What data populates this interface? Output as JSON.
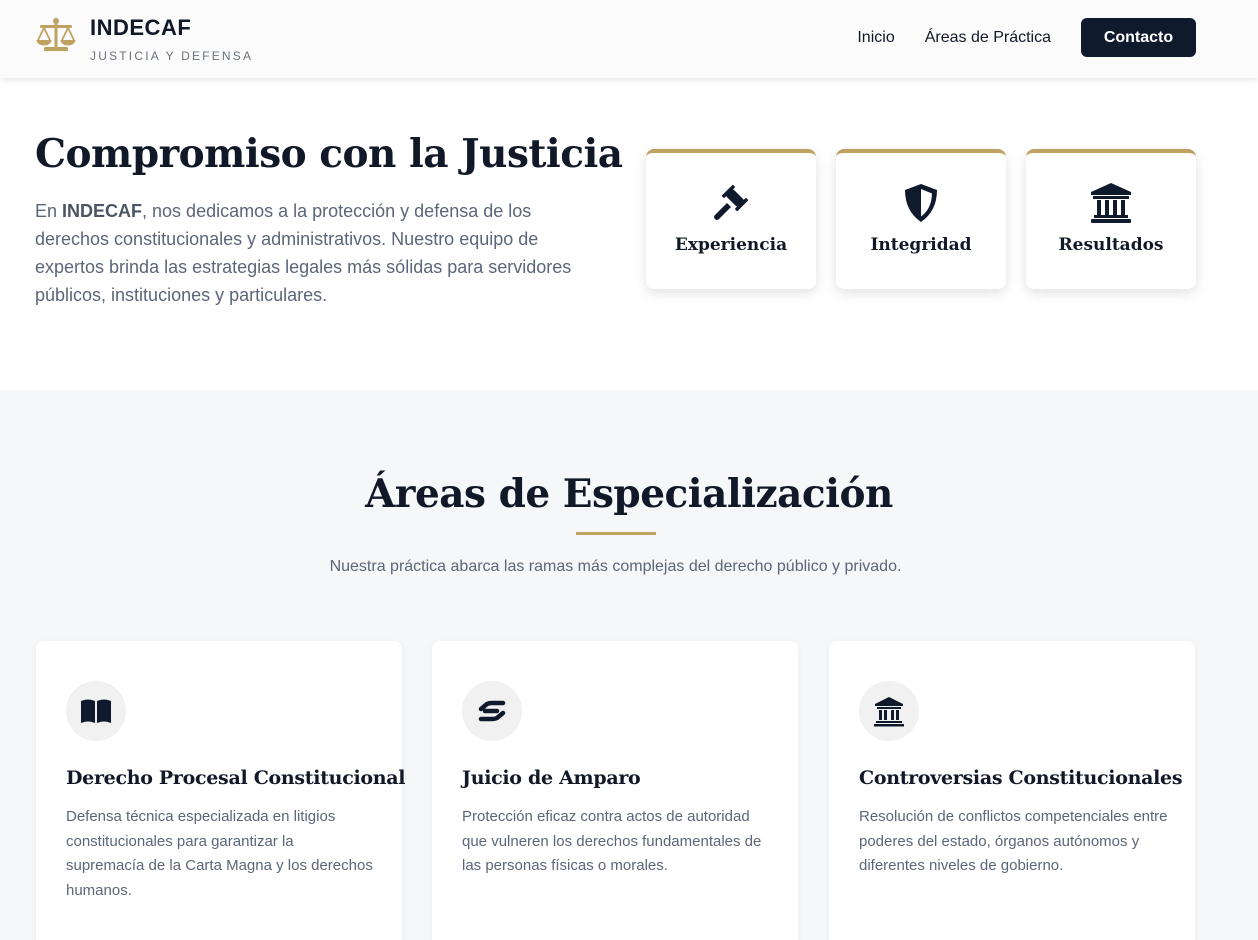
{
  "brand": {
    "name": "INDECAF",
    "tagline": "JUSTICIA Y DEFENSA",
    "logo_icon": "balance-scale-icon",
    "accent_color": "#bfa262"
  },
  "nav": {
    "items": [
      {
        "label": "Inicio"
      },
      {
        "label": "Áreas de Práctica"
      }
    ],
    "cta_label": "Contacto",
    "cta_color": "#0f1b2d"
  },
  "hero": {
    "title": "Compromiso con la Justicia",
    "text_prefix": "En ",
    "text_strong": "INDECAF",
    "text_rest": ", nos dedicamos a la protección y defensa de los derechos constitucionales y administrativos. Nuestro equipo de expertos brinda las estrategias legales más sólidas para servidores públicos, instituciones y particulares.",
    "values": [
      {
        "label": "Experiencia",
        "icon": "gavel-icon"
      },
      {
        "label": "Integridad",
        "icon": "shield-icon"
      },
      {
        "label": "Resultados",
        "icon": "institution-icon"
      }
    ]
  },
  "areas": {
    "title": "Áreas de Especialización",
    "subtitle": "Nuestra práctica abarca las ramas más complejas del derecho público y privado.",
    "cards": [
      {
        "title": "Derecho Procesal Constitucional",
        "text": "Defensa técnica especializada en litigios constitucionales para garantizar la supremacía de la Carta Magna y los derechos humanos.",
        "icon": "book-open-icon"
      },
      {
        "title": "Juicio de Amparo",
        "text": "Protección eficaz contra actos de autoridad que vulneren los derechos fundamentales de las personas físicas o morales.",
        "icon": "helping-hand-icon"
      },
      {
        "title": "Controversias Constitucionales",
        "text": "Resolución de conflictos competenciales entre poderes del estado, órganos autónomos y diferentes niveles de gobierno.",
        "icon": "landmark-icon"
      }
    ]
  }
}
